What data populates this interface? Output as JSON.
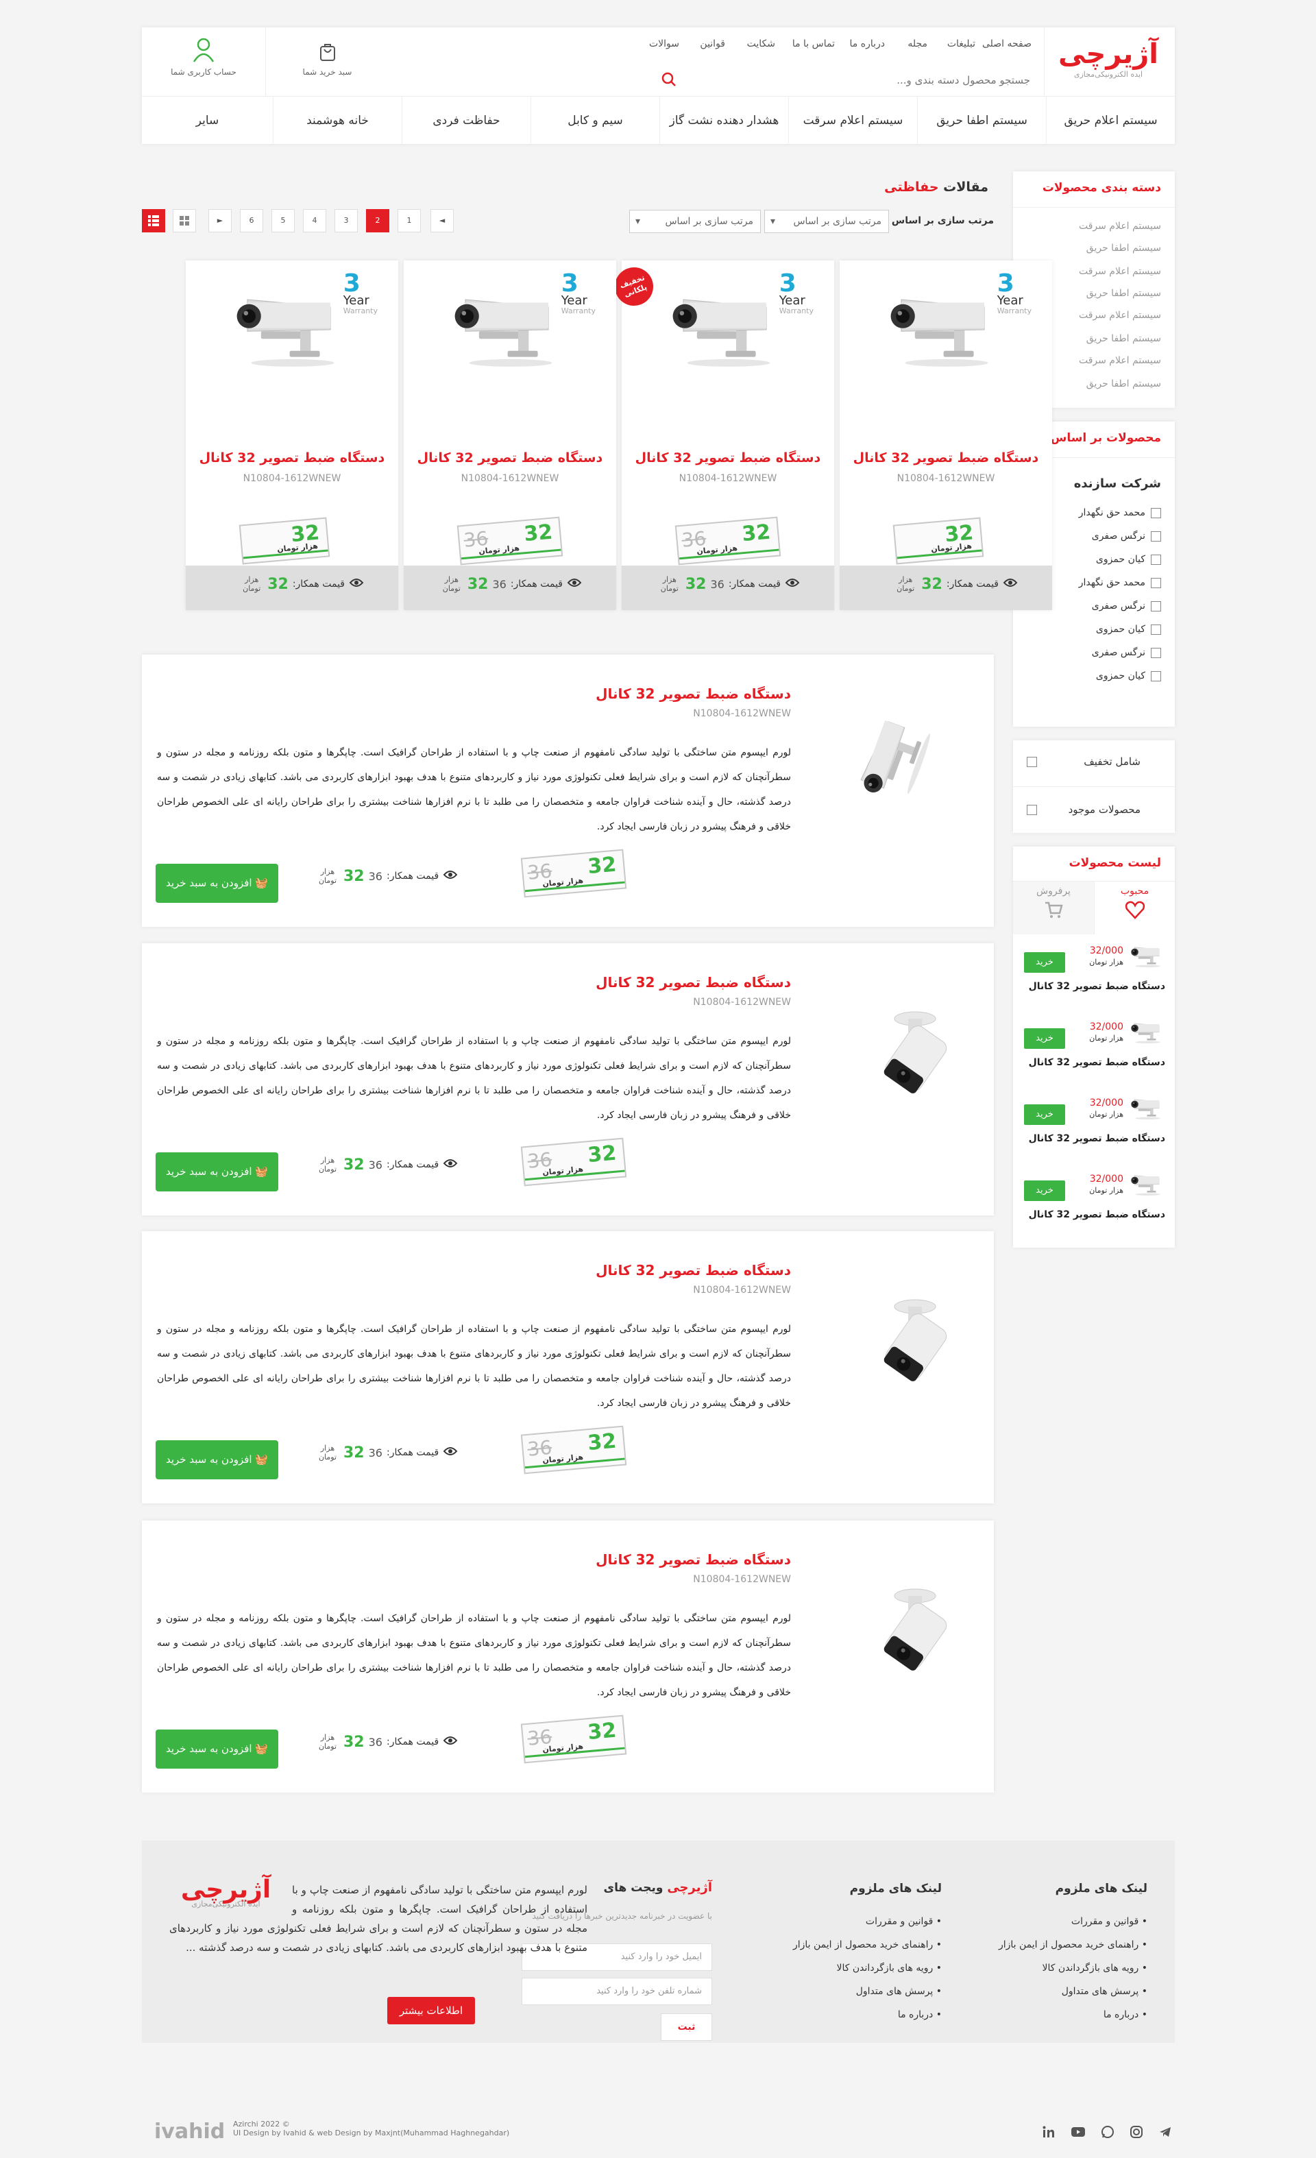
{
  "brand": {
    "logo": "آژیرچی",
    "tagline": "ایده الکترونیکی‌مجازی",
    "footer_logo": "آژیرچی",
    "footer_tagline": "ایده الکترونیکی‌مجازی",
    "widget_logo": "آژیرچی",
    "accent": "#e31e25",
    "green": "#3cb443"
  },
  "header": {
    "top_links": [
      "صفحه اصلی",
      "تبلیغات",
      "مجله",
      "درباره ما",
      "تماس با ما",
      "شکایت",
      "قوانین",
      "سوالات"
    ],
    "search_placeholder": "جستجو محصول دسته بندی و...",
    "cart_label": "سبد خرید شما",
    "account_label": "حساب کاربری شما",
    "nav": [
      "سیستم اعلام حریق",
      "سیستم اطفا حریق",
      "سیستم اعلام سرقت",
      "هشدار دهنده نشت گاز",
      "سیم و کابل",
      "حفاظت فردی",
      "خانه هوشمند",
      "سایر"
    ]
  },
  "sidebar": {
    "categories_title": "دسته بندی محصولات",
    "categories": [
      "سیستم اعلام سرقت",
      "سیستم اطفا حریق",
      "سیستم اعلام سرقت",
      "سیستم اطفا حریق",
      "سیستم اعلام سرقت",
      "سیستم اطفا حریق",
      "سیستم اعلام سرقت",
      "سیستم اطفا حریق"
    ],
    "expand_symbol": "+",
    "filter_title": "محصولات بر اساس",
    "maker_title": "شرکت سازنده",
    "makers": [
      "محمد حق نگهدار",
      "نرگس صفری",
      "کیان حمزوی",
      "محمد حق نگهدار",
      "نرگس صفری",
      "کیان حمزوی",
      "نرگس صفری",
      "کیان حمزوی"
    ],
    "discount_label": "شامل تخفیف",
    "available_label": "محصولات موجود",
    "list_title": "لیست محصولات",
    "tab_popular": "محبوب",
    "tab_bestseller": "پرفروش",
    "mini_items": [
      {
        "price": "32/000",
        "unit": "هزار تومان",
        "buy": "خرید",
        "name": "دستگاه ضبط تصویر 32 کانال"
      },
      {
        "price": "32/000",
        "unit": "هزار تومان",
        "buy": "خرید",
        "name": "دستگاه ضبط تصویر 32 کانال"
      },
      {
        "price": "32/000",
        "unit": "هزار تومان",
        "buy": "خرید",
        "name": "دستگاه ضبط تصویر 32 کانال"
      },
      {
        "price": "32/000",
        "unit": "هزار تومان",
        "buy": "خرید",
        "name": "دستگاه ضبط تصویر 32 کانال"
      }
    ]
  },
  "main": {
    "title_prefix": "مقالات",
    "title_highlight": "حفاظتی",
    "sort_label": "مرتب سازی بر اساس",
    "sort_select_1": "مرتب سازی بر اساس",
    "sort_select_2": "مرتب سازی بر اساس",
    "pages": [
      "1",
      "2",
      "3",
      "4",
      "5",
      "6"
    ],
    "active_page": "2",
    "prev_symbol": "◄",
    "next_symbol": "►"
  },
  "grid_products": [
    {
      "name": "دستگاه ضبط تصویر 32 کانال",
      "code": "N10804-1612WNEW",
      "warranty_num": "3",
      "warranty_word": "Year",
      "warranty_sub": "Warranty",
      "price": "32",
      "old_price": "",
      "unit": "هزار تومان",
      "colleague_label": "قیمت همکار:",
      "colleague_old": "",
      "colleague_price": "32",
      "colleague_unit": "هزار تومان",
      "badge": ""
    },
    {
      "name": "دستگاه ضبط تصویر 32 کانال",
      "code": "N10804-1612WNEW",
      "warranty_num": "3",
      "warranty_word": "Year",
      "warranty_sub": "Warranty",
      "price": "32",
      "old_price": "36",
      "unit": "هزار تومان",
      "colleague_label": "قیمت همکار:",
      "colleague_old": "36",
      "colleague_price": "32",
      "colleague_unit": "هزار تومان",
      "badge": "تخفیف پلکانی"
    },
    {
      "name": "دستگاه ضبط تصویر 32 کانال",
      "code": "N10804-1612WNEW",
      "warranty_num": "3",
      "warranty_word": "Year",
      "warranty_sub": "Warranty",
      "price": "32",
      "old_price": "36",
      "unit": "هزار تومان",
      "colleague_label": "قیمت همکار:",
      "colleague_old": "36",
      "colleague_price": "32",
      "colleague_unit": "هزار تومان",
      "badge": ""
    },
    {
      "name": "دستگاه ضبط تصویر 32 کانال",
      "code": "N10804-1612WNEW",
      "warranty_num": "3",
      "warranty_word": "Year",
      "warranty_sub": "Warranty",
      "price": "32",
      "old_price": "",
      "unit": "هزار تومان",
      "colleague_label": "قیمت همکار:",
      "colleague_old": "",
      "colleague_price": "32",
      "colleague_unit": "هزار تومان",
      "badge": ""
    }
  ],
  "list_products": [
    {
      "name": "دستگاه ضبط تصویر 32 کانال",
      "code": "N10804-1612WNEW",
      "desc": "لورم ایپسوم متن ساختگی با تولید سادگی نامفهوم از صنعت چاپ و با استفاده از طراحان گرافیک است. چاپگرها و متون بلکه روزنامه و مجله در ستون و سطرآنچنان که لازم است و برای شرایط فعلی تکنولوژی مورد نیاز و کاربردهای متنوع با هدف بهبود ابزارهای کاربردی می باشد. کتابهای زیادی در شصت و سه درصد گذشته، حال و آینده شناخت فراوان جامعه و متخصصان را می طلبد تا با نرم افزارها شناخت بیشتری را برای طراحان رایانه ای علی الخصوص طراحان خلاقی و فرهنگ پیشرو در زبان فارسی ایجاد کرد.",
      "price": "32",
      "old_price": "36",
      "unit": "هزار تومان",
      "colleague_label": "قیمت همکار:",
      "colleague_old": "36",
      "colleague_price": "32",
      "colleague_unit": "هزار تومان",
      "buy": "افزودن به سبد خرید"
    },
    {
      "name": "دستگاه ضبط تصویر 32 کانال",
      "code": "N10804-1612WNEW",
      "desc": "لورم ایپسوم متن ساختگی با تولید سادگی نامفهوم از صنعت چاپ و با استفاده از طراحان گرافیک است. چاپگرها و متون بلکه روزنامه و مجله در ستون و سطرآنچنان که لازم است و برای شرایط فعلی تکنولوژی مورد نیاز و کاربردهای متنوع با هدف بهبود ابزارهای کاربردی می باشد. کتابهای زیادی در شصت و سه درصد گذشته، حال و آینده شناخت فراوان جامعه و متخصصان را می طلبد تا با نرم افزارها شناخت بیشتری را برای طراحان رایانه ای علی الخصوص طراحان خلاقی و فرهنگ پیشرو در زبان فارسی ایجاد کرد.",
      "price": "32",
      "old_price": "36",
      "unit": "هزار تومان",
      "colleague_label": "قیمت همکار:",
      "colleague_old": "36",
      "colleague_price": "32",
      "colleague_unit": "هزار تومان",
      "buy": "افزودن به سبد خرید"
    },
    {
      "name": "دستگاه ضبط تصویر 32 کانال",
      "code": "N10804-1612WNEW",
      "desc": "لورم ایپسوم متن ساختگی با تولید سادگی نامفهوم از صنعت چاپ و با استفاده از طراحان گرافیک است. چاپگرها و متون بلکه روزنامه و مجله در ستون و سطرآنچنان که لازم است و برای شرایط فعلی تکنولوژی مورد نیاز و کاربردهای متنوع با هدف بهبود ابزارهای کاربردی می باشد. کتابهای زیادی در شصت و سه درصد گذشته، حال و آینده شناخت فراوان جامعه و متخصصان را می طلبد تا با نرم افزارها شناخت بیشتری را برای طراحان رایانه ای علی الخصوص طراحان خلاقی و فرهنگ پیشرو در زبان فارسی ایجاد کرد.",
      "price": "32",
      "old_price": "36",
      "unit": "هزار تومان",
      "colleague_label": "قیمت همکار:",
      "colleague_old": "36",
      "colleague_price": "32",
      "colleague_unit": "هزار تومان",
      "buy": "افزودن به سبد خرید"
    },
    {
      "name": "دستگاه ضبط تصویر 32 کانال",
      "code": "N10804-1612WNEW",
      "desc": "لورم ایپسوم متن ساختگی با تولید سادگی نامفهوم از صنعت چاپ و با استفاده از طراحان گرافیک است. چاپگرها و متون بلکه روزنامه و مجله در ستون و سطرآنچنان که لازم است و برای شرایط فعلی تکنولوژی مورد نیاز و کاربردهای متنوع با هدف بهبود ابزارهای کاربردی می باشد. کتابهای زیادی در شصت و سه درصد گذشته، حال و آینده شناخت فراوان جامعه و متخصصان را می طلبد تا با نرم افزارها شناخت بیشتری را برای طراحان رایانه ای علی الخصوص طراحان خلاقی و فرهنگ پیشرو در زبان فارسی ایجاد کرد.",
      "price": "32",
      "old_price": "36",
      "unit": "هزار تومان",
      "colleague_label": "قیمت همکار:",
      "colleague_old": "36",
      "colleague_price": "32",
      "colleague_unit": "هزار تومان",
      "buy": "افزودن به سبد خرید"
    }
  ],
  "footer": {
    "links_title_1": "لینک های ملزوم",
    "links_1": [
      "قوانین و مقررات",
      "راهنمای خرید محصول از ایمن بازار",
      "رویه های بازگرداندن کالا",
      "پرسش های متداول",
      "درباره ما"
    ],
    "links_title_2": "لینک های ملزوم",
    "links_2": [
      "قوانین و مقررات",
      "راهنمای خرید محصول از ایمن بازار",
      "رویه های بازگرداندن کالا",
      "پرسش های متداول",
      "درباره ما"
    ],
    "widget_title": "ویجت های",
    "widget_text": "با عضویت در خبرنامه جدیدترین خبرها را دریافت کنید",
    "email_placeholder": "ایمیل خود را وارد کنید",
    "phone_placeholder": "شماره تلفن خود را وارد کنید",
    "register": "ثبت",
    "about": "لورم ایپسوم متن ساختگی با تولید سادگی نامفهوم از صنعت چاپ و با استفاده از طراحان گرافیک است. چاپگرها و متون بلکه روزنامه و مجله در ستون و سطرآنچنان که لازم است و برای شرایط فعلی تکنولوژی مورد نیاز و کاربردهای متنوع با هدف بهبود ابزارهای کاربردی می باشد. کتابهای زیادی در شصت و سه درصد گذشته ...",
    "more": "اطلاعات بیشتر",
    "copyright": "Azirchi 2022 ©",
    "credits": "UI Design by Ivahid & web Design by Maxjnt(Muhammad Haghnegahdar)",
    "signature": "ivahid",
    "socials": [
      "telegram-icon",
      "instagram-icon",
      "whatsapp-icon",
      "youtube-icon",
      "linkedin-icon"
    ]
  }
}
